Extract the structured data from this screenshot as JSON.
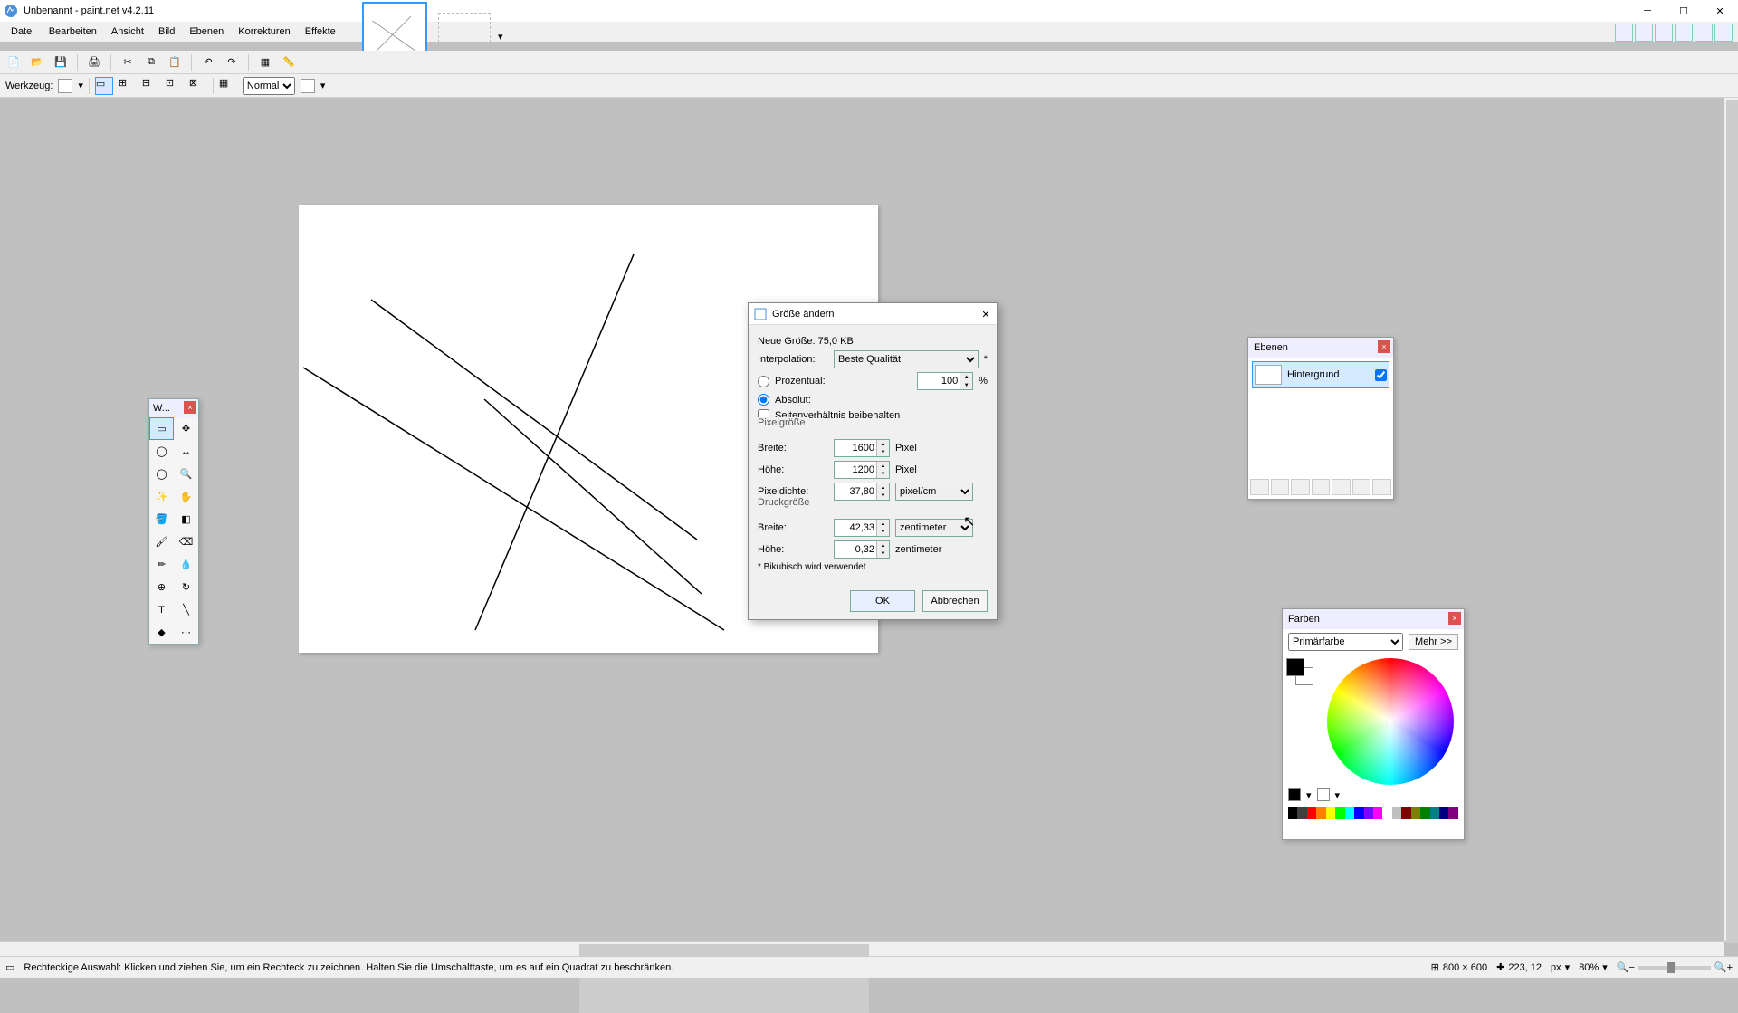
{
  "window": {
    "title": "Unbenannt - paint.net v4.2.11"
  },
  "menu": {
    "items": [
      "Datei",
      "Bearbeiten",
      "Ansicht",
      "Bild",
      "Ebenen",
      "Korrekturen",
      "Effekte"
    ]
  },
  "optionbar": {
    "tool_label": "Werkzeug:",
    "blend_label": "Normal"
  },
  "tools": {
    "title": "W..."
  },
  "layers": {
    "title": "Ebenen",
    "item": "Hintergrund"
  },
  "colors": {
    "title": "Farben",
    "dropdown": "Primärfarbe",
    "more": "Mehr >>",
    "palette": [
      "#000000",
      "#404040",
      "#ff0000",
      "#ff8000",
      "#ffff00",
      "#00ff00",
      "#00ffff",
      "#0000ff",
      "#8000ff",
      "#ff00ff",
      "#ffffff",
      "#c0c0c0",
      "#800000",
      "#808000",
      "#008000",
      "#008080",
      "#000080",
      "#800080"
    ]
  },
  "dialog": {
    "title": "Größe ändern",
    "new_size": "Neue Größe: 75,0 KB",
    "interpolation_label": "Interpolation:",
    "interpolation_value": "Beste Qualität",
    "percent_label": "Prozentual:",
    "percent_value": "100",
    "absolute_label": "Absolut:",
    "aspect_label": "Seitenverhältnis beibehalten",
    "pixelsize_label": "Pixelgröße",
    "width_label": "Breite:",
    "height_label": "Höhe:",
    "width_value": "1600",
    "height_value": "1200",
    "pixel_unit": "Pixel",
    "density_label": "Pixeldichte:",
    "density_value": "37,80",
    "density_unit": "pixel/cm",
    "printsize_label": "Druckgröße",
    "print_width": "42,33",
    "print_height": "0,32",
    "print_unit": "zentimeter",
    "footnote": "* Bikubisch wird verwendet",
    "ok": "OK",
    "cancel": "Abbrechen"
  },
  "status": {
    "hint": "Rechteckige Auswahl: Klicken und ziehen Sie, um ein Rechteck zu zeichnen. Halten Sie die Umschalttaste, um es auf ein Quadrat zu beschränken.",
    "docsize": "800 × 600",
    "coords": "223, 12",
    "unit": "px",
    "zoom": "80%"
  }
}
